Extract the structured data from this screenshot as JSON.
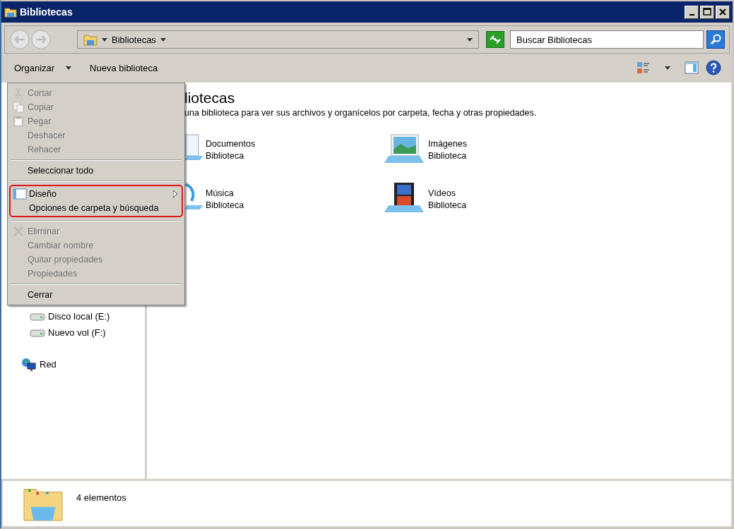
{
  "window": {
    "title": "Bibliotecas"
  },
  "address": {
    "path": "Bibliotecas"
  },
  "search": {
    "placeholder": "Buscar Bibliotecas"
  },
  "toolbar": {
    "buttons": [
      "Organizar",
      "Nueva biblioteca"
    ]
  },
  "menu": {
    "groups": [
      {
        "highlighted": false,
        "items": [
          {
            "label": "Cortar",
            "kind": "cut",
            "disabled": true
          },
          {
            "label": "Copiar",
            "kind": "copy",
            "disabled": true
          },
          {
            "label": "Pegar",
            "kind": "paste",
            "disabled": true
          },
          {
            "label": "Deshacer",
            "kind": "plain",
            "disabled": true
          },
          {
            "label": "Rehacer",
            "kind": "plain",
            "disabled": true
          }
        ]
      },
      {
        "highlighted": false,
        "items": [
          {
            "label": "Seleccionar todo",
            "kind": "plain",
            "disabled": false
          }
        ]
      },
      {
        "highlighted": true,
        "items": [
          {
            "label": "Diseño",
            "kind": "layout",
            "disabled": false,
            "submenu": true
          },
          {
            "label": "Opciones de carpeta y búsqueda",
            "kind": "plain",
            "disabled": false
          }
        ]
      },
      {
        "highlighted": false,
        "items": [
          {
            "label": "Eliminar",
            "kind": "delete",
            "disabled": true
          },
          {
            "label": "Cambiar nombre",
            "kind": "plain",
            "disabled": true
          },
          {
            "label": "Quitar propiedades",
            "kind": "plain",
            "disabled": true
          },
          {
            "label": "Propiedades",
            "kind": "plain",
            "disabled": true
          }
        ]
      },
      {
        "highlighted": false,
        "items": [
          {
            "label": "Cerrar",
            "kind": "plain",
            "disabled": false
          }
        ]
      }
    ]
  },
  "sidebar": {
    "items": [
      {
        "label": "Disco local (E:)",
        "kind": "drive"
      },
      {
        "label": "Nuevo vol (F:)",
        "kind": "drive"
      },
      {
        "label": "Red",
        "kind": "network"
      }
    ]
  },
  "content": {
    "heading": "liotecas",
    "description": "una biblioteca para ver sus archivos y organícelos por carpeta, fecha y otras propiedades.",
    "libraries": [
      {
        "name": "Documentos",
        "type": "Biblioteca",
        "kind": "documents"
      },
      {
        "name": "Imágenes",
        "type": "Biblioteca",
        "kind": "pictures"
      },
      {
        "name": "Música",
        "type": "Biblioteca",
        "kind": "music"
      },
      {
        "name": "Vídeos",
        "type": "Biblioteca",
        "kind": "videos"
      }
    ]
  },
  "status_bar": {
    "count": "4 elementos"
  }
}
